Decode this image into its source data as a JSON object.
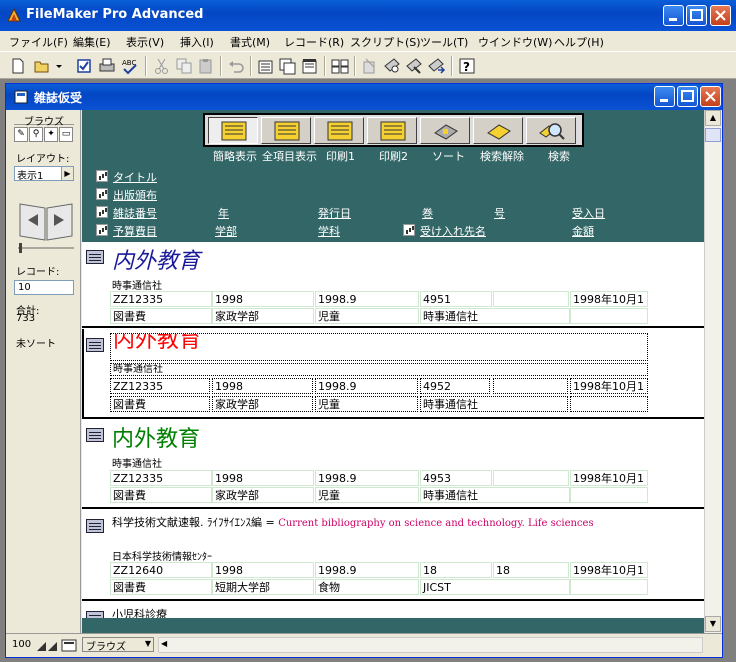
{
  "app": {
    "title": "FileMaker Pro Advanced"
  },
  "menu": [
    "ファイル(F)",
    "編集(E)",
    "表示(V)",
    "挿入(I)",
    "書式(M)",
    "レコード(R)",
    "スクリプト(S)",
    "ツール(T)",
    "ウインドウ(W)",
    "ヘルプ(H)"
  ],
  "doc": {
    "title": "雑誌仮受"
  },
  "status": {
    "mode": "ブラウズ",
    "layout_label": "レイアウト:",
    "layout_value": "表示1",
    "record_label": "レコード:",
    "record_value": "10",
    "total_label": "合計:",
    "total_value": "733",
    "sort_state": "未ソート",
    "zoom": "100",
    "mode_select": "ブラウズ"
  },
  "header_buttons": [
    "簡略表示",
    "全項目表示",
    "印刷1",
    "印刷2",
    "ソート",
    "検索解除",
    "検索"
  ],
  "field_labels": {
    "title": "タイトル",
    "publisher": "出版頒布",
    "issn": "雑誌番号",
    "year": "年",
    "issued": "発行日",
    "volume": "巻",
    "number": "号",
    "received": "受入日",
    "budget": "予算費目",
    "dept": "学部",
    "subject": "学科",
    "source": "受け入れ先名",
    "amount": "金額"
  },
  "records": [
    {
      "title": "内外教育",
      "title_color": "#1a1a99",
      "publisher": "時事通信社",
      "row1": [
        "ZZ12335",
        "1998",
        "1998.9",
        "4951",
        "",
        "1998年10月1"
      ],
      "row2": [
        "図書費",
        "家政学部",
        "児童",
        "時事通信社",
        ""
      ]
    },
    {
      "title": "内外教育",
      "title_color": "#ff0000",
      "publisher": "時事通信社",
      "row1": [
        "ZZ12335",
        "1998",
        "1998.9",
        "4952",
        "",
        "1998年10月1"
      ],
      "row2": [
        "図書費",
        "家政学部",
        "児童",
        "時事通信社",
        ""
      ]
    },
    {
      "title": "内外教育",
      "title_color": "#008000",
      "publisher": "時事通信社",
      "row1": [
        "ZZ12335",
        "1998",
        "1998.9",
        "4953",
        "",
        "1998年10月1"
      ],
      "row2": [
        "図書費",
        "家政学部",
        "児童",
        "時事通信社",
        ""
      ]
    },
    {
      "title_jp": "科学技術文献速報. ﾗｲﾌｻｲｴﾝｽ編 =",
      "title_en": "Current bibliography on science and technology. Life sciences",
      "title_en_color": "#cc0066",
      "publisher": "日本科学技術情報ｾﾝﾀｰ",
      "row1": [
        "ZZ12640",
        "1998",
        "1998.9",
        "18",
        "18",
        "1998年10月1"
      ],
      "row2": [
        "図書費",
        "短期大学部",
        "食物",
        "JICST",
        ""
      ]
    },
    {
      "title_jp": "小児科診療"
    }
  ]
}
